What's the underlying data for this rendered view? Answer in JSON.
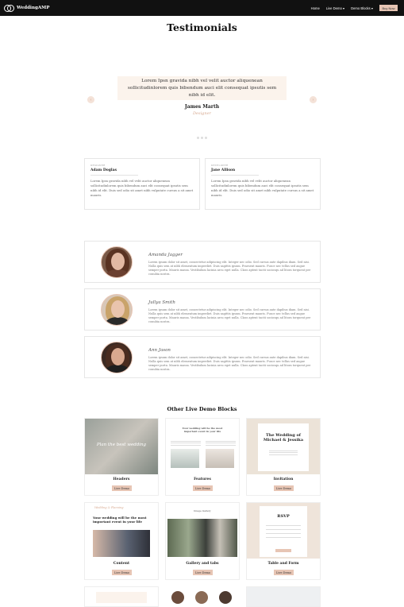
{
  "nav": {
    "logo_text": "WeddingAMP",
    "links": [
      "Home",
      "Live Demo ▾",
      "Demo Blocks ▾"
    ],
    "buy_label": "Buy Now"
  },
  "page_title": "Testimonials",
  "slider": {
    "quote": "Lorem Ipsn gravida nibh vel velit auctor aliquenean sollicitudinlorem quis bibendum auci elit consequat ipsutis sem nibh id elit.",
    "name": "James Marth",
    "role": "Designer",
    "prev_icon": "‹",
    "next_icon": "›"
  },
  "cards": [
    {
      "role": "DESIGNER",
      "name": "Adam Doglas",
      "text": "Lorem Ipsn gravida nibh vel velit auctor aliquenean sollicitudinlorem quis bibendum auci elit consequat ipsutis sem nibh id elit. Duis sed odio sit amet nibh vulputate cursus a sit amet mauris."
    },
    {
      "role": "DEVELOPER",
      "name": "Jane Allison",
      "text": "Lorem Ipsn gravida nibh vel velit auctor aliquenean sollicitudinlorem quis bibendum auci elit consequat ipsutis sem nibh id elit. Duis sed odio sit amet nibh vulputate cursus a sit amet mauris."
    }
  ],
  "rows": [
    {
      "name": "Amanda Jagger",
      "text": "Lorem ipsum dolor sit amet, consectetur adipiscing elit. Integer nec odio. Sed cursus ante dapibus diam. Sed nisi. Nulla quis sem at nibh elementum imperdiet. Duis sagittis ipsum. Praesent mauris. Fusce nec tellus sed augue semper porta. Mauris massa. Vestibulum lacinia arcu eget nulla. Class aptent taciti sociosqu ad litora torquent per conubia nostra."
    },
    {
      "name": "Jullya Smith",
      "text": "Lorem ipsum dolor sit amet, consectetur adipiscing elit. Integer nec odio. Sed cursus ante dapibus diam. Sed nisi. Nulla quis sem at nibh elementum imperdiet. Duis sagittis ipsum. Praesent mauris. Fusce nec tellus sed augue semper porta. Mauris massa. Vestibulum lacinia arcu eget nulla. Class aptent taciti sociosqu ad litora torquent per conubia nostra."
    },
    {
      "name": "Ann Jason",
      "text": "Lorem ipsum dolor sit amet, consectetur adipiscing elit. Integer nec odio. Sed cursus ante dapibus diam. Sed nisi. Nulla quis sem at nibh elementum imperdiet. Duis sagittis ipsum. Praesent mauris. Fusce nec tellus sed augue semper porta. Mauris massa. Vestibulum lacinia arcu eget nulla. Class aptent taciti sociosqu ad litora torquent per conubia nostra."
    }
  ],
  "other_title": "Other Live Demo Blocks",
  "demos": [
    {
      "label": "Headers",
      "button": "Live Demo",
      "image_text": "Plan the best wedding"
    },
    {
      "label": "Features",
      "button": "Live Demo",
      "image_text": "Your wedding will be the most important event in your life"
    },
    {
      "label": "Invitation",
      "button": "Live Demo",
      "image_text": "The Wedding of Michael & Jessika"
    },
    {
      "label": "Content",
      "button": "Live Demo",
      "image_text": "Your wedding will be the most important event in your life",
      "tagline": "Wedding & Planning"
    },
    {
      "label": "Gallery and tabs",
      "button": "Live Demo",
      "image_text": "Image Gallery"
    },
    {
      "label": "Table and Form",
      "button": "Live Demo",
      "image_text": "RSVP"
    }
  ],
  "colors": {
    "accent": "#e7c5b4",
    "accent_text": "#d7a990",
    "nav_bg": "#111111"
  }
}
